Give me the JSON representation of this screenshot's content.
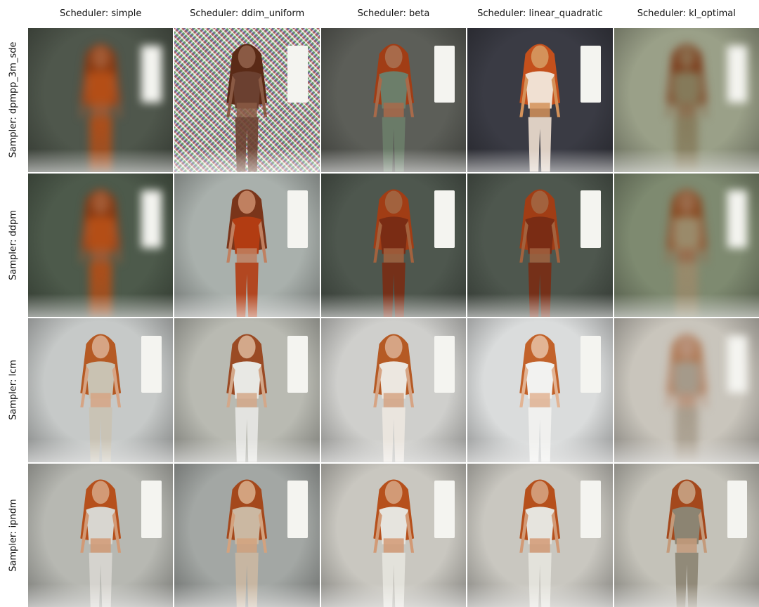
{
  "columns": [
    "Scheduler: simple",
    "Scheduler: ddim_uniform",
    "Scheduler: beta",
    "Scheduler: linear_quadratic",
    "Scheduler: kl_optimal"
  ],
  "rows": [
    "Sampler: dpmpp_3m_sde",
    "Sampler: ddpm",
    "Sampler: lcm",
    "Sampler: ipndm"
  ],
  "cells": [
    [
      {
        "style": "blurred",
        "bg": "#4f574c",
        "hair": "#8a3a12",
        "outfit": "#b44e16",
        "skin": "#a25a34"
      },
      {
        "style": "noisy",
        "bg": "#d9d4cc",
        "hair": "#5a2a16",
        "outfit": "#6b4030",
        "skin": "#8a5a44"
      },
      {
        "style": "soft",
        "bg": "#5c5e58",
        "hair": "#a13d15",
        "outfit": "#6c7e6a",
        "skin": "#a86a4a"
      },
      {
        "style": "soft",
        "bg": "#3a3b44",
        "hair": "#c4501c",
        "outfit": "#f0e0d2",
        "skin": "#d4925a"
      },
      {
        "style": "blurred",
        "bg": "#9aa088",
        "hair": "#7c3b1a",
        "outfit": "#857a5a",
        "skin": "#8a6a4a"
      }
    ],
    [
      {
        "style": "blurred",
        "bg": "#4d5a4b",
        "hair": "#8a3a12",
        "outfit": "#b44e16",
        "skin": "#a25a34"
      },
      {
        "style": "soft",
        "bg": "#a9b0ac",
        "hair": "#7a351a",
        "outfit": "#b23c12",
        "skin": "#c08060"
      },
      {
        "style": "soft",
        "bg": "#4e574e",
        "hair": "#a13d15",
        "outfit": "#7a2c14",
        "skin": "#a2623e"
      },
      {
        "style": "soft",
        "bg": "#4e574e",
        "hair": "#a13d15",
        "outfit": "#7a2c14",
        "skin": "#a2623e"
      },
      {
        "style": "blurred",
        "bg": "#7e8a70",
        "hair": "#8a4a22",
        "outfit": "#9a8a6a",
        "skin": "#9a6a4a"
      }
    ],
    [
      {
        "style": "soft",
        "bg": "#c6c9c8",
        "hair": "#b55a24",
        "outfit": "#c9c2b2",
        "skin": "#d6a484"
      },
      {
        "style": "soft",
        "bg": "#b9bab2",
        "hair": "#9a4a24",
        "outfit": "#e8e8e4",
        "skin": "#d3a88a"
      },
      {
        "style": "soft",
        "bg": "#cfcfcc",
        "hair": "#b55a24",
        "outfit": "#ece7e0",
        "skin": "#d6a484"
      },
      {
        "style": "soft",
        "bg": "#dadcdc",
        "hair": "#c2622a",
        "outfit": "#f2f2f0",
        "skin": "#e2b494"
      },
      {
        "style": "blurred",
        "bg": "#c9c5bc",
        "hair": "#b07a56",
        "outfit": "#a59a8a",
        "skin": "#b89078"
      }
    ],
    [
      {
        "style": "soft",
        "bg": "#b7b8b2",
        "hair": "#b6501c",
        "outfit": "#d8d6d0",
        "skin": "#d29a76"
      },
      {
        "style": "soft",
        "bg": "#a3a7a4",
        "hair": "#a4481c",
        "outfit": "#cbb8a2",
        "skin": "#d3a27e"
      },
      {
        "style": "soft",
        "bg": "#c9c7c0",
        "hair": "#b6501c",
        "outfit": "#e6e4de",
        "skin": "#d29a76"
      },
      {
        "style": "soft",
        "bg": "#c9c7c0",
        "hair": "#b6501c",
        "outfit": "#e6e4de",
        "skin": "#d29a76"
      },
      {
        "style": "soft",
        "bg": "#c4c2b9",
        "hair": "#a4481c",
        "outfit": "#8c8472",
        "skin": "#c49a7a"
      }
    ]
  ]
}
